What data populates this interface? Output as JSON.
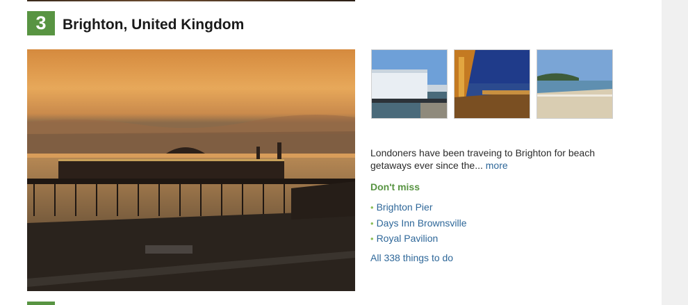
{
  "destination": {
    "rank": "3",
    "title": "Brighton, United Kingdom"
  },
  "main_photo": {
    "subject": "Brighton Palace Pier at sunset"
  },
  "thumbnails": [
    {
      "subject": "Palace Pier entrance"
    },
    {
      "subject": "Carousel at dusk"
    },
    {
      "subject": "Crowded beach"
    }
  ],
  "description": {
    "text": "Londoners have been traveing to Brighton for beach getaways ever since the...",
    "more_label": "more"
  },
  "dont_miss": {
    "heading": "Don't miss",
    "items": [
      {
        "label": "Brighton Pier"
      },
      {
        "label": "Days Inn Brownsville"
      },
      {
        "label": "Royal Pavilion"
      }
    ]
  },
  "all_things_label": "All 338 things to do",
  "colors": {
    "badge_green": "#589442",
    "link_blue": "#2e6799",
    "bullet_green": "#8cbf5a",
    "gutter_gray": "#f0f0f0"
  },
  "icons": {
    "bullet": "bullet-icon"
  }
}
